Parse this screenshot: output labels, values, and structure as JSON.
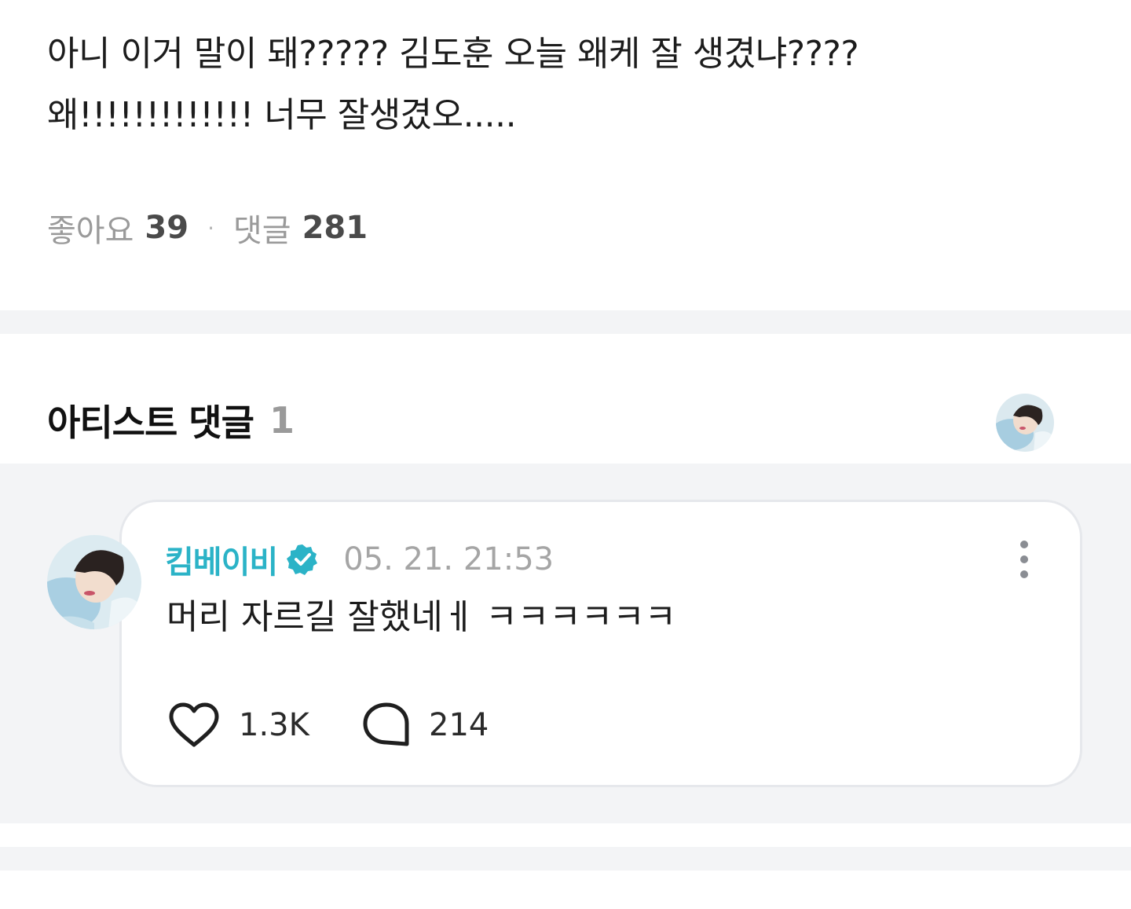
{
  "post": {
    "body": "아니 이거 말이 돼????? 김도훈 오늘 왜케 잘 생겼냐????\n왜!!!!!!!!!!!!! 너무 잘생겼오.....",
    "likes_label": "좋아요",
    "likes_count": "39",
    "separator": "·",
    "comments_label": "댓글",
    "comments_count": "281"
  },
  "artist_comments": {
    "title": "아티스트 댓글",
    "count": "1"
  },
  "comments": [
    {
      "author": "킴베이비",
      "verified": true,
      "time": "05. 21. 21:53",
      "text": "머리 자르길 잘했네ㅔ ㅋㅋㅋㅋㅋㅋ",
      "likes": "1.3K",
      "replies": "214"
    }
  ],
  "colors": {
    "accent": "#2bb3c7",
    "band": "#f3f4f6",
    "muted": "#9a9a9a"
  },
  "icons": {
    "verified": "verified-badge-icon",
    "like": "heart-icon",
    "reply": "speech-bubble-icon",
    "more": "more-vertical-icon"
  }
}
